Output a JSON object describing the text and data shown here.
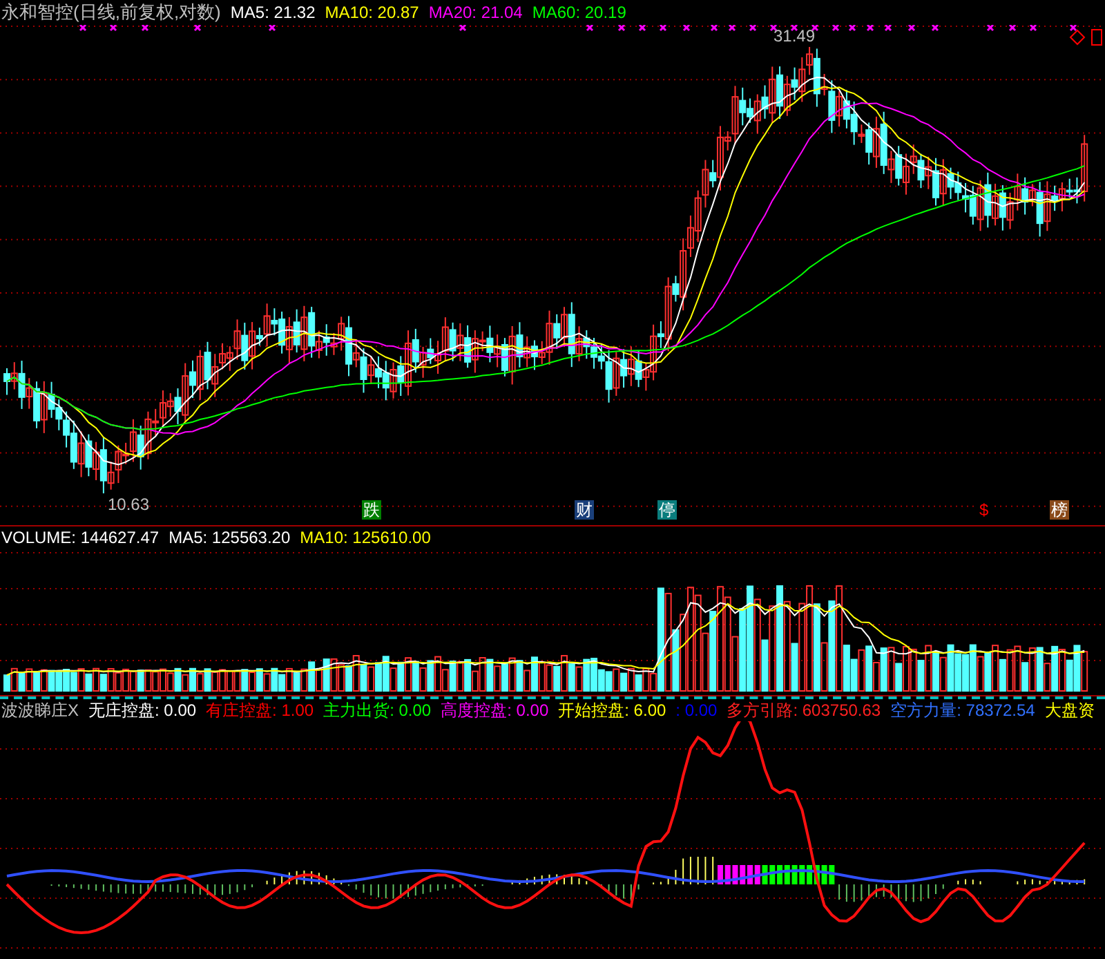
{
  "title": "永和智控(日线,前复权,对数)",
  "ma_legend": [
    {
      "label": "MA5: 21.32",
      "color": "#ffffff"
    },
    {
      "label": "MA10: 20.87",
      "color": "#ffff00"
    },
    {
      "label": "MA20: 21.04",
      "color": "#ff00ff"
    },
    {
      "label": "MA60: 20.19",
      "color": "#00ff00"
    }
  ],
  "high_label": "31.49",
  "low_label": "10.63",
  "event_markers": [
    {
      "text": "跌",
      "color": "#008000"
    },
    {
      "text": "财",
      "color": "#1a3f7a"
    },
    {
      "text": "停",
      "color": "#0a7d7d"
    },
    {
      "text": "$",
      "color": "#000000"
    },
    {
      "text": "榜",
      "color": "#8a4a1a"
    }
  ],
  "volume_legend": [
    {
      "label": "VOLUME: 144627.47",
      "color": "#ffffff"
    },
    {
      "label": "MA5: 125563.20",
      "color": "#ffffff"
    },
    {
      "label": "MA10: 125610.00",
      "color": "#ffff00"
    }
  ],
  "indicator_legend": [
    {
      "label": "波波睇庄X",
      "color": "#c0c0c0"
    },
    {
      "label": "无庄控盘: 0.00",
      "color": "#ffffff"
    },
    {
      "label": "有庄控盘: 1.00",
      "color": "#ff0000"
    },
    {
      "label": "主力出货: 0.00",
      "color": "#00ff00"
    },
    {
      "label": "高度控盘: 0.00",
      "color": "#ff00ff"
    },
    {
      "label": "开始控盘: 6.00",
      "color": "#ffff00"
    },
    {
      "label": ": 0.00",
      "color": "#0000ff"
    },
    {
      "label": "多方引路: 603750.63",
      "color": "#ff2020"
    },
    {
      "label": "空方力量: 78372.54",
      "color": "#3070ff"
    },
    {
      "label": "大盘资",
      "color": "#ffff00"
    }
  ]
}
